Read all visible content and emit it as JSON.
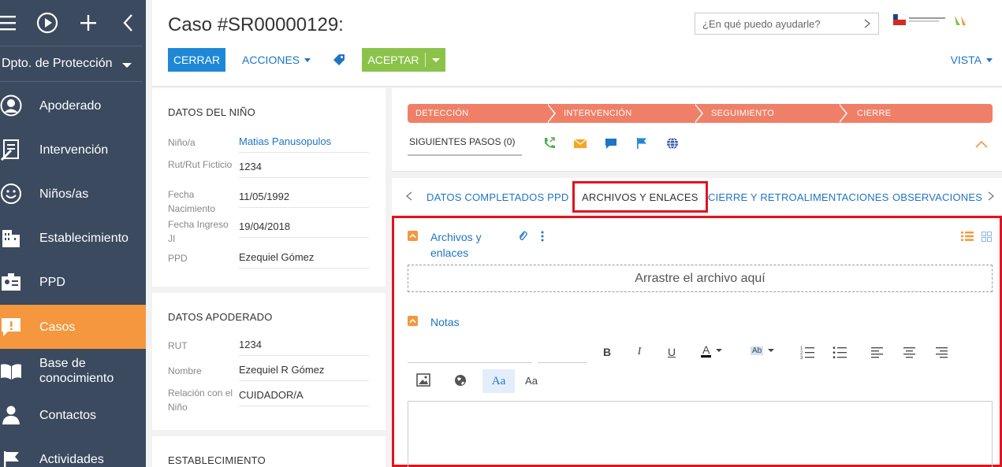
{
  "sidebar": {
    "department": "Dpto. de Protección",
    "items": [
      {
        "label": "Apoderado",
        "icon": "user-circle-icon"
      },
      {
        "label": "Intervención",
        "icon": "clipboard-pen-icon"
      },
      {
        "label": "Niños/as",
        "icon": "smiley-icon"
      },
      {
        "label": "Establecimiento",
        "icon": "building-icon"
      },
      {
        "label": "PPD",
        "icon": "id-card-icon"
      },
      {
        "label": "Casos",
        "icon": "alert-bubble-icon"
      },
      {
        "label": "Base de conocimiento",
        "icon": "open-book-icon"
      },
      {
        "label": "Contactos",
        "icon": "person-icon"
      },
      {
        "label": "Actividades",
        "icon": "flag-icon"
      }
    ]
  },
  "header": {
    "title": "Caso #SR00000129:",
    "close_label": "CERRAR",
    "actions_label": "ACCIONES",
    "accept_label": "ACEPTAR",
    "search_placeholder": "¿En qué puedo ayudarle?",
    "view_label": "VISTA"
  },
  "child_card": {
    "title": "DATOS DEL NIÑO",
    "fields": [
      {
        "label": "Niño/a",
        "value": "Matias Panusopulos"
      },
      {
        "label": "Rut/Rut Ficticio",
        "value": "1234"
      },
      {
        "label": "Fecha Nacimiento",
        "value": "11/05/1992"
      },
      {
        "label": "Fecha Ingreso JI",
        "value": "19/04/2018"
      },
      {
        "label": "PPD",
        "value": "Ezequiel Gómez"
      }
    ]
  },
  "guardian_card": {
    "title": "DATOS APODERADO",
    "fields": [
      {
        "label": "RUT",
        "value": "1234"
      },
      {
        "label": "Nombre",
        "value": "Ezequiel R Gómez"
      },
      {
        "label": "Relación con el Niño",
        "value": "CUIDADOR/A"
      }
    ]
  },
  "establishment_card": {
    "title": "ESTABLECIMIENTO"
  },
  "stages": [
    "DETECCIÓN",
    "INTERVENCIÓN",
    "SEGUIMIENTO",
    "CIERRE"
  ],
  "next_steps_label": "SIGUIENTES PASOS (0)",
  "tabs": [
    {
      "label": "DATOS COMPLETADOS PPD",
      "active": false
    },
    {
      "label": "ARCHIVOS Y ENLACES",
      "active": true
    },
    {
      "label": "CIERRE Y RETROALIMENTACIONES",
      "active": false
    },
    {
      "label": "OBSERVACIONES",
      "active": false
    }
  ],
  "files_section": {
    "title_line1": "Archivos y",
    "title_line2": "enlaces",
    "dropzone_text": "Arrastre el archivo aquí"
  },
  "notes_section": {
    "title": "Notas",
    "toolbar": {
      "bold": "B",
      "italic": "I",
      "underline": "U",
      "font_color": "A",
      "highlight": "Ab",
      "style_active": "Aa",
      "style_plain": "Aa"
    }
  },
  "colors": {
    "sidebar_bg": "#3b4a5e",
    "active_nav": "#f5973f",
    "primary_blue": "#1e88d6",
    "accept_green": "#8bc34a",
    "stage_salmon": "#ef8067",
    "highlight_red": "#e0141e"
  }
}
